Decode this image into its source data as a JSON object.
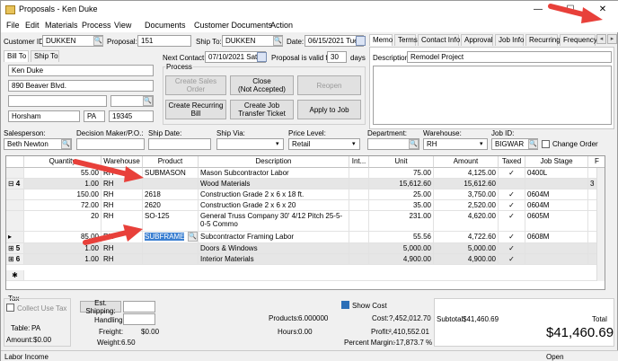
{
  "window": {
    "title": "Proposals - Ken Duke",
    "minimize": "—",
    "maximize": "☐",
    "close": "✕"
  },
  "menu": [
    "File",
    "Edit",
    "Materials",
    "Process",
    "View",
    "Documents",
    "Customer Documents",
    "Action"
  ],
  "header": {
    "customer_id_label": "Customer ID:",
    "customer_id": "DUKKEN",
    "proposal_label": "Proposal:",
    "proposal": "151",
    "ship_to_label": "Ship To:",
    "ship_to": "DUKKEN",
    "date_label": "Date:",
    "date": "06/15/2021 Tue",
    "bill_to_tab": "Bill To",
    "ship_to_tab": "Ship To",
    "next_contact_label": "Next Contact:",
    "next_contact": "07/10/2021 Sat",
    "valid_label": "Proposal is valid for",
    "valid_days": "30",
    "days_label": "days"
  },
  "address": {
    "name": "Ken Duke",
    "street": "890 Beaver Blvd.",
    "city": "Horsham",
    "state": "PA",
    "zip": "19345"
  },
  "process": {
    "label": "Process",
    "create_sales_order": "Create Sales Order",
    "close": "Close\n(Not Accepted)",
    "reopen": "Reopen",
    "create_recurring_bill": "Create Recurring Bill",
    "create_job_transfer": "Create Job Transfer Ticket",
    "apply_to_job": "Apply to Job"
  },
  "right_tabs": [
    "Memo",
    "Terms",
    "Contact Info",
    "Approval",
    "Job Info",
    "Recurring",
    "Frequency"
  ],
  "description_label": "Description:",
  "description": "Remodel Project",
  "fields": {
    "salesperson_label": "Salesperson:",
    "salesperson": "Beth Newton",
    "decision_label": "Decision Maker/P.O.:",
    "ship_date_label": "Ship Date:",
    "ship_via_label": "Ship Via:",
    "price_level_label": "Price Level:",
    "price_level": "Retail",
    "department_label": "Department:",
    "warehouse_label": "Warehouse:",
    "warehouse": "RH",
    "job_id_label": "Job ID:",
    "job_id": "BIGWAR",
    "change_order_label": "Change Order"
  },
  "grid": {
    "columns": [
      "Quantity",
      "Warehouse",
      "Product",
      "Description",
      "Int...",
      "Unit",
      "Amount",
      "Taxed",
      "Job Stage",
      "F"
    ],
    "rows": [
      {
        "q": "55.00",
        "w": "RH",
        "p": "SUBMASON",
        "d": "Mason Subcontractor Labor",
        "u": "75.00",
        "a": "4,125.00",
        "t": "✓",
        "s": "0400L",
        "f": ""
      },
      {
        "num": "4",
        "q": "1.00",
        "w": "RH",
        "p": "",
        "d": "Wood Materials",
        "u": "15,612.60",
        "a": "15,612.60",
        "t": "",
        "s": "",
        "f": "3"
      },
      {
        "q": "150.00",
        "w": "RH",
        "p": "2618",
        "d": "Construction Grade 2 x 6 x 18 ft.",
        "u": "25.00",
        "a": "3,750.00",
        "t": "✓",
        "s": "0604M",
        "f": ""
      },
      {
        "q": "72.00",
        "w": "RH",
        "p": "2620",
        "d": "Construction Grade 2 x 6 x 20",
        "u": "35.00",
        "a": "2,520.00",
        "t": "✓",
        "s": "0604M",
        "f": ""
      },
      {
        "q": "20",
        "w": "RH",
        "p": "SO-125",
        "d": "General Truss Company 30' 4/12 Pitch 25-5-0-5 Commo",
        "u": "231.00",
        "a": "4,620.00",
        "t": "✓",
        "s": "0605M",
        "f": ""
      },
      {
        "q": "85.00",
        "w": "RH",
        "p": "SUBFRAME",
        "d": "Subcontractor Framing Labor",
        "u": "55.56",
        "a": "4,722.60",
        "t": "✓",
        "s": "0608M",
        "f": ""
      },
      {
        "num": "5",
        "q": "1.00",
        "w": "RH",
        "p": "",
        "d": "Doors & Windows",
        "u": "5,000.00",
        "a": "5,000.00",
        "t": "✓",
        "s": "",
        "f": ""
      },
      {
        "num": "6",
        "q": "1.00",
        "w": "RH",
        "p": "",
        "d": "Interior Materials",
        "u": "4,900.00",
        "a": "4,900.00",
        "t": "✓",
        "s": "",
        "f": ""
      }
    ],
    "new_row": "✱"
  },
  "footer": {
    "tax_label": "Tax",
    "collect_use_tax": "Collect Use Tax",
    "table_label": "Table:",
    "table": "PA",
    "amount_label": "Amount:",
    "amount": "$0.00",
    "est_shipping": "Est. Shipping:",
    "handling": "Handling:",
    "freight_label": "Freight:",
    "freight": "$0.00",
    "weight_label": "Weight:",
    "weight": "6.50",
    "products_label": "Products:",
    "products": "6.000000",
    "hours_label": "Hours:",
    "hours": "0.00",
    "show_cost": "Show Cost",
    "cost_label": "Cost:",
    "cost": "?,452,012.70",
    "profit_label": "Profit:",
    "profit": "²,410,552.01",
    "margin_label": "Percent Margin:",
    "margin": "-17,873.7 %",
    "subtotal_label": "Subtotal:",
    "subtotal": "$41,460.69",
    "total_label": "Total",
    "total": "$41,460.69"
  },
  "status": {
    "left": "Labor Income",
    "right": "Open"
  },
  "colors": {
    "accent": "#2c6fb7",
    "arrow": "#e8403a",
    "selection": "#3b7fd1"
  }
}
